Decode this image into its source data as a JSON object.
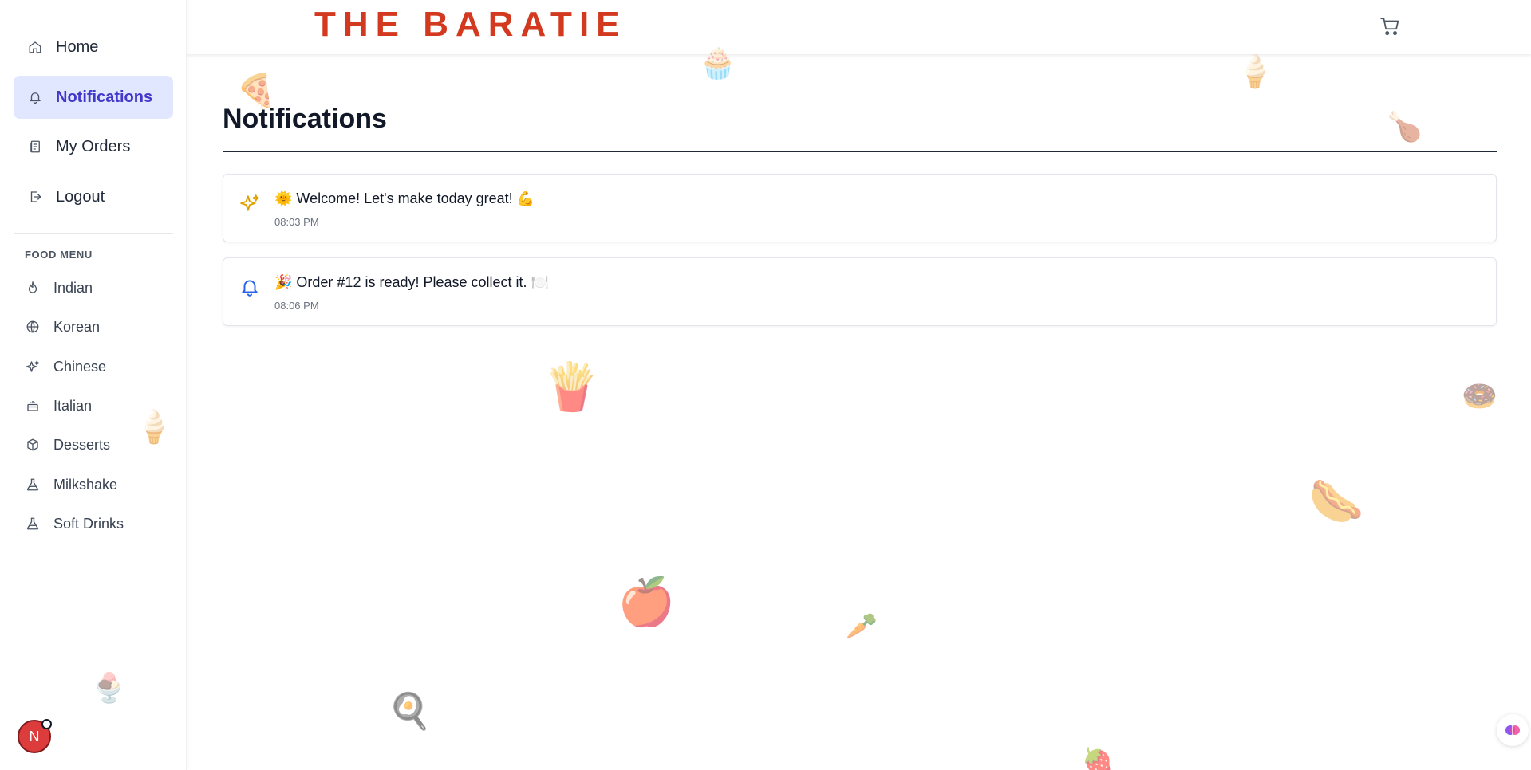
{
  "brand": "THE BARATIE",
  "nav": [
    {
      "label": "Home",
      "icon": "home-icon"
    },
    {
      "label": "Notifications",
      "icon": "bell-icon",
      "active": true
    },
    {
      "label": "My Orders",
      "icon": "receipt-icon"
    },
    {
      "label": "Logout",
      "icon": "logout-icon"
    }
  ],
  "food_menu": {
    "title": "FOOD MENU",
    "items": [
      {
        "label": "Indian",
        "icon": "flame-icon"
      },
      {
        "label": "Korean",
        "icon": "globe-icon"
      },
      {
        "label": "Chinese",
        "icon": "sparkles-icon"
      },
      {
        "label": "Italian",
        "icon": "cake-icon"
      },
      {
        "label": "Desserts",
        "icon": "box-icon"
      },
      {
        "label": "Milkshake",
        "icon": "flask-icon"
      },
      {
        "label": "Soft Drinks",
        "icon": "flask-icon"
      }
    ]
  },
  "avatar": {
    "initial": "N"
  },
  "page": {
    "title": "Notifications"
  },
  "notifications": [
    {
      "message": "🌞 Welcome! Let's make today great! 💪",
      "time": "08:03 PM",
      "icon": "sparkles-icon"
    },
    {
      "message": "🎉 Order #12 is ready! Please collect it. 🍽️",
      "time": "08:06 PM",
      "icon": "bell-icon"
    }
  ],
  "colors": {
    "brand": "#d2391f",
    "active_bg": "#e0e7ff",
    "active_text": "#4338ca",
    "avatar": "#dc3c3c"
  },
  "decorations": [
    "🍕",
    "🧁",
    "🍦",
    "🍗",
    "🍦",
    "🍟",
    "🍩",
    "🌭",
    "🍎",
    "🥕",
    "🍳",
    "🍓",
    "🍨"
  ]
}
